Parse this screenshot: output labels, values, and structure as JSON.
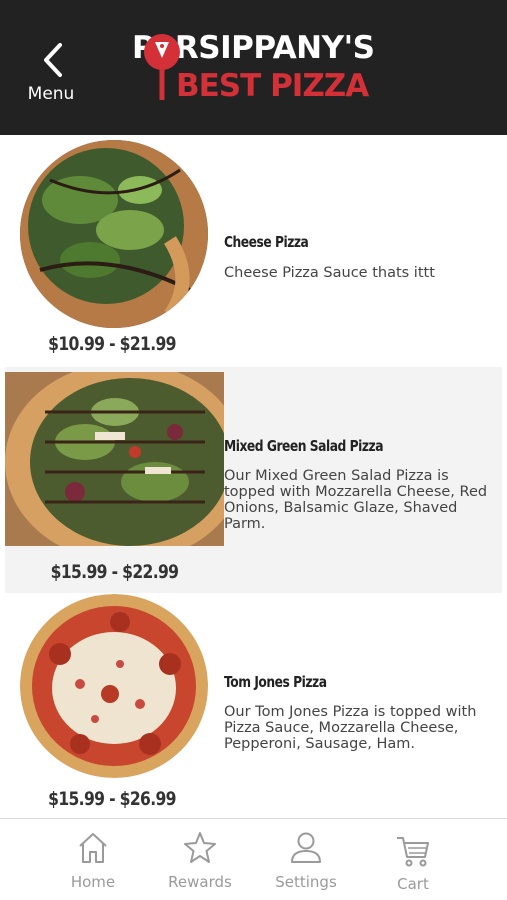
{
  "header": {
    "back_label": "Menu",
    "logo_line1": "PARSIPPANY'S",
    "logo_line2": "BEST PIZZA",
    "colors": {
      "background": "#222222",
      "brand_red": "#d33038"
    }
  },
  "items": [
    {
      "name": "Cheese Pizza",
      "description": "Cheese Pizza Sauce thats ittt",
      "price": "$10.99 - $21.99",
      "image": "salad-pizza-photo"
    },
    {
      "name": "Mixed Green Salad Pizza",
      "description": "Our Mixed Green Salad Pizza is topped with Mozzarella Cheese, Red Onions, Balsamic Glaze, Shaved Parm.",
      "price": "$15.99 - $22.99",
      "image": "mixed-green-pizza-photo"
    },
    {
      "name": "Tom Jones Pizza",
      "description": "Our Tom Jones Pizza is topped with Pizza Sauce, Mozzarella Cheese, Pepperoni, Sausage, Ham.",
      "price": "$15.99 - $26.99",
      "image": "pepperoni-pizza-photo"
    }
  ],
  "tabbar": {
    "tabs": [
      {
        "label": "Home",
        "icon": "home-icon"
      },
      {
        "label": "Rewards",
        "icon": "star-icon"
      },
      {
        "label": "Settings",
        "icon": "user-icon"
      },
      {
        "label": "Cart",
        "icon": "cart-icon"
      }
    ]
  }
}
